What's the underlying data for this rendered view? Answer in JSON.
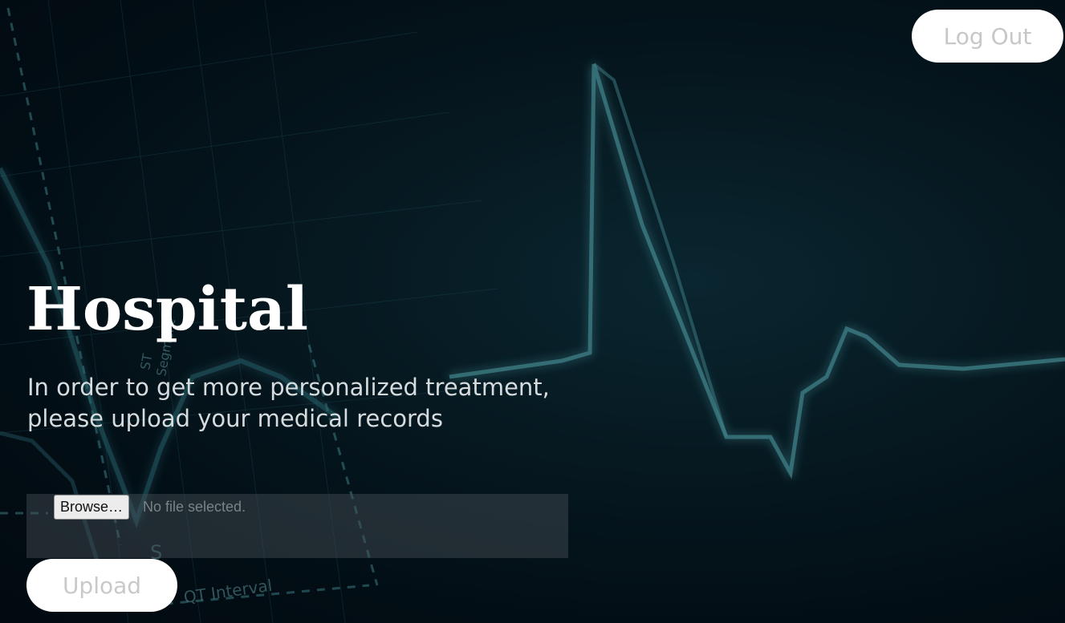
{
  "header": {
    "logout_label": "Log Out"
  },
  "hero": {
    "title": "Hospital",
    "subtitle_line1": "In order to get more personalized treatment,",
    "subtitle_line2": "please upload your medical records"
  },
  "upload_form": {
    "browse_label": "Browse…",
    "file_status": "No file selected.",
    "submit_label": "Upload"
  },
  "background": {
    "ecg_labels": [
      "QT Interval",
      "ST",
      "Segment",
      "S"
    ],
    "colors": {
      "base": "#03111a",
      "ecg_line": "#3f7f87",
      "grid": "#1c4a55"
    }
  }
}
